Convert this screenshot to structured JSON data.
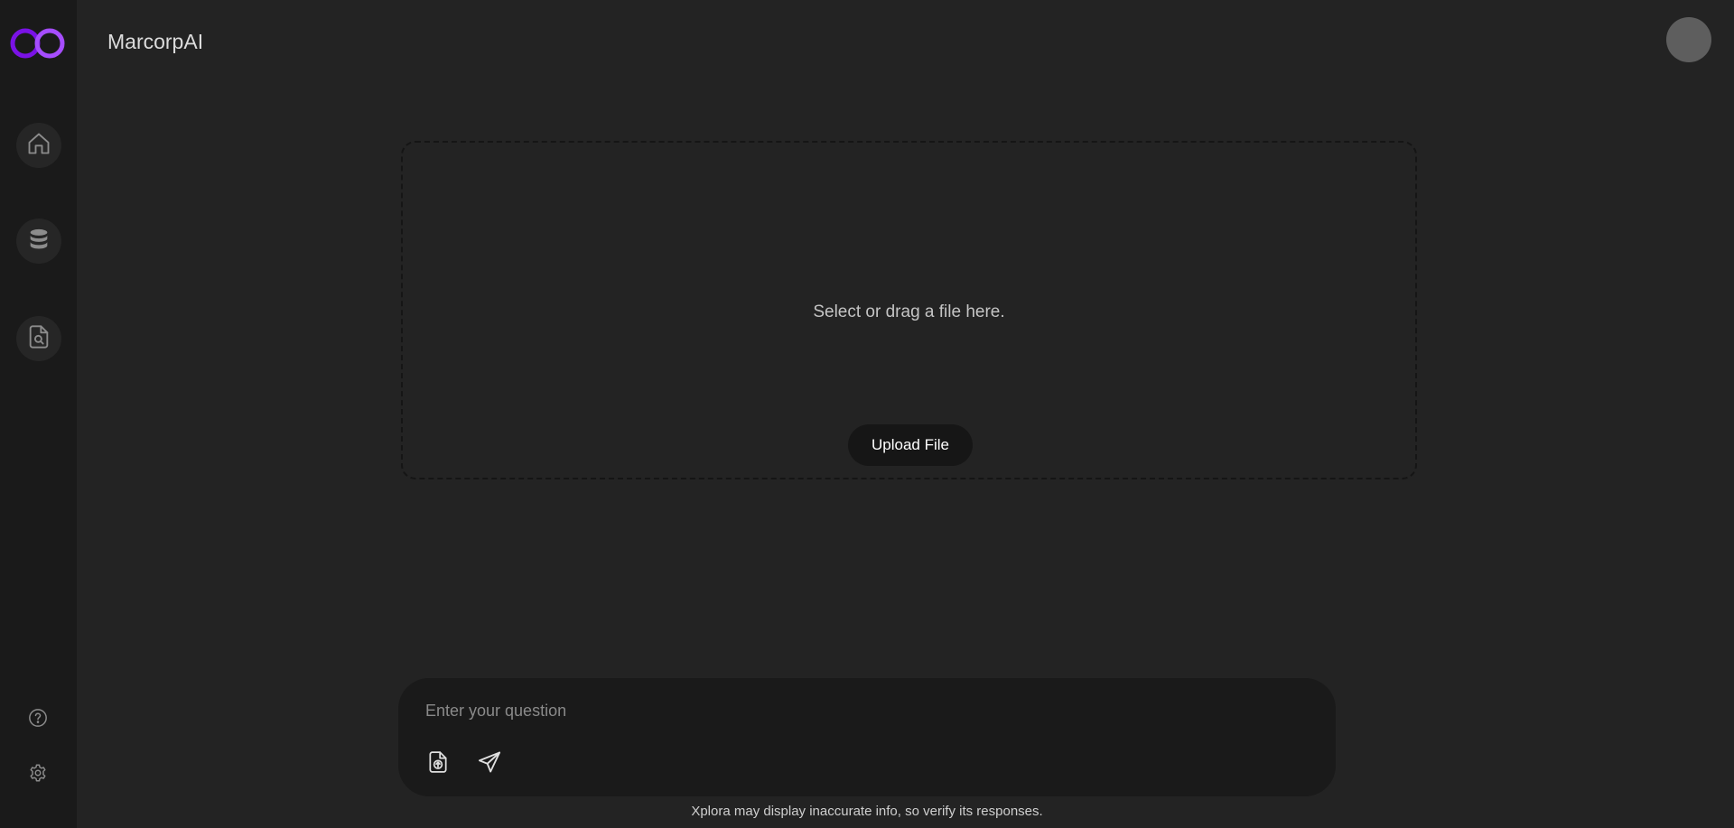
{
  "app": {
    "title": "MarcorpAI"
  },
  "theme": {
    "accent": "#8a1cf0",
    "accent_light": "#a64dff",
    "background": "#232323",
    "sidebar": "#1a1a1a"
  },
  "sidebar": {
    "logo": "infinity-logo",
    "items": [
      {
        "icon": "home-icon"
      },
      {
        "icon": "database-icon"
      },
      {
        "icon": "document-search-icon"
      }
    ],
    "utilities": [
      {
        "icon": "help-icon"
      },
      {
        "icon": "gear-icon"
      }
    ]
  },
  "upload": {
    "prompt": "Select or drag a file here.",
    "button_label": "Upload File"
  },
  "chat": {
    "placeholder": "Enter your question",
    "upload_icon": "file-upload-icon",
    "send_icon": "send-icon"
  },
  "footer": {
    "disclaimer": "Xplora may display inaccurate info, so verify its responses."
  }
}
